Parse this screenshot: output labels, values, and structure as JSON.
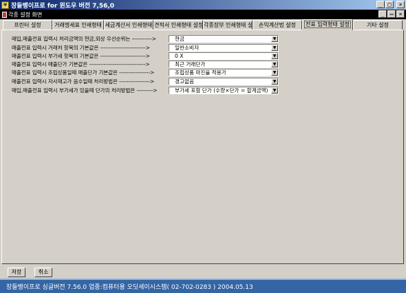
{
  "window": {
    "title": "장들벵이프로 for 윈도우 버전 7,56,0",
    "app_icon": "Ψ",
    "min": "_",
    "max": "□",
    "close": "×"
  },
  "child_window": {
    "title": "각종 설정 화면",
    "min": "_",
    "restore": "▭",
    "close": "×"
  },
  "tabs": [
    {
      "label": "프린터 설정"
    },
    {
      "label": "거래명세표 인쇄형태"
    },
    {
      "label": "세금계산서 인쇄형태"
    },
    {
      "label": "견적서 인쇄형태 설정"
    },
    {
      "label": "각종장부 인쇄형태 설"
    },
    {
      "label": "손익계산법 설정"
    },
    {
      "label": "전표 입력형태 설정"
    },
    {
      "label": "기타 설정"
    }
  ],
  "active_tab": "전표 입력형태 설정",
  "settings": [
    {
      "label": "매입,매출전표 입력시 처리금액의 현금,외상 우선순위는 ----------->",
      "value": "현금"
    },
    {
      "label": "매출전표 입력시 거래처 항목의 기본값은 ------------------------->",
      "value": "일반소비자"
    },
    {
      "label": "매출전표 입력시 부가세 항목의 기본값은 ------------------------->",
      "value": "0 X"
    },
    {
      "label": "매출전표 입력시 매출단가 기본값은 ------------------------------->",
      "value": "최근 거래단가"
    },
    {
      "label": "매출전표 입력시 조립상품일때 매출단가 기본값은 ----------------->",
      "value": "조립상품 마진율 적용가"
    },
    {
      "label": "매출전표 입력시 자사재고가 음수일때 처리방법은 ----------------->",
      "value": "경고없음"
    },
    {
      "label": "매입,매출전표 입력시 부가세가 있을때 단가의 처리방법은 --------->",
      "value": "부가세 포함 단가 (수량×단가 = 합계금액)"
    }
  ],
  "dropdown_glyph": "▼",
  "buttons": {
    "save": "저장",
    "cancel": "취소"
  },
  "statusbar": {
    "text": "장들벵이프로 싱글버전 7.56.0   업종:컴퓨터용   오딧세이시스템( 02-702-0283 )   2004.05.13"
  },
  "colors": {
    "titlebar_start": "#0a246a",
    "statusbar": "#3465a4"
  }
}
